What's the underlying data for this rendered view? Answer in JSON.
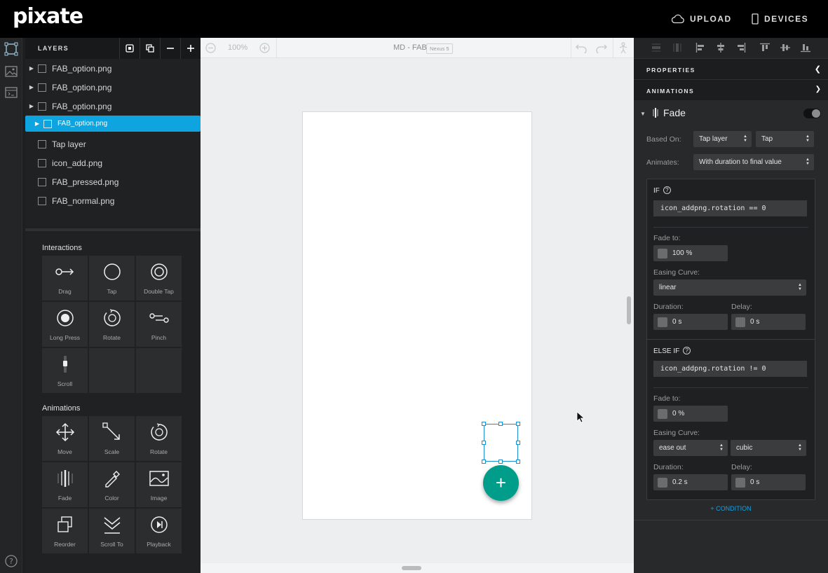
{
  "app": {
    "logo": "pixate"
  },
  "topbar": {
    "upload_label": "UPLOAD",
    "devices_label": "DEVICES"
  },
  "layers": {
    "title": "LAYERS",
    "items": [
      {
        "label": "FAB_option.png",
        "expandable": true,
        "selected": false
      },
      {
        "label": "FAB_option.png",
        "expandable": true,
        "selected": false
      },
      {
        "label": "FAB_option.png",
        "expandable": true,
        "selected": false
      },
      {
        "label": "FAB_option.png",
        "expandable": true,
        "selected": true
      },
      {
        "label": "Tap layer",
        "expandable": false,
        "selected": false
      },
      {
        "label": "icon_add.png",
        "expandable": false,
        "selected": false
      },
      {
        "label": "FAB_pressed.png",
        "expandable": false,
        "selected": false
      },
      {
        "label": "FAB_normal.png",
        "expandable": false,
        "selected": false
      }
    ]
  },
  "library": {
    "interactions_title": "Interactions",
    "interactions": [
      "Drag",
      "Tap",
      "Double Tap",
      "Long Press",
      "Rotate",
      "Pinch",
      "Scroll"
    ],
    "animations_title": "Animations",
    "animations": [
      "Move",
      "Scale",
      "Rotate",
      "Fade",
      "Color",
      "Image",
      "Reorder",
      "Scroll To",
      "Playback"
    ]
  },
  "canvas": {
    "zoom": "100%",
    "doc_title": "MD - FAB",
    "device": "Nexus 5",
    "fab_symbol": "+"
  },
  "panel": {
    "properties_label": "PROPERTIES",
    "animations_label": "ANIMATIONS",
    "animation": {
      "name": "Fade",
      "enabled": true,
      "based_on_label": "Based On:",
      "based_on_layer": "Tap layer",
      "based_on_event": "Tap",
      "animates_label": "Animates:",
      "animates_value": "With duration to final value"
    },
    "if_block": {
      "label": "IF",
      "help": "?",
      "expression": "icon_addpng.rotation == 0",
      "fade_to_label": "Fade to:",
      "fade_to": "100 %",
      "easing_label": "Easing Curve:",
      "easing": "linear",
      "duration_label": "Duration:",
      "duration": "0 s",
      "delay_label": "Delay:",
      "delay": "0 s"
    },
    "else_block": {
      "label": "ELSE IF",
      "help": "?",
      "expression": "icon_addpng.rotation != 0",
      "fade_to_label": "Fade to:",
      "fade_to": "0 %",
      "easing_label": "Easing Curve:",
      "easing": "ease out",
      "easing_type": "cubic",
      "duration_label": "Duration:",
      "duration": "0.2 s",
      "delay_label": "Delay:",
      "delay": "0 s"
    },
    "add_condition": "+ CONDITION"
  },
  "colors": {
    "accent": "#0ea4e0",
    "fab": "#009e8a",
    "selection": "#1a8fd6"
  }
}
